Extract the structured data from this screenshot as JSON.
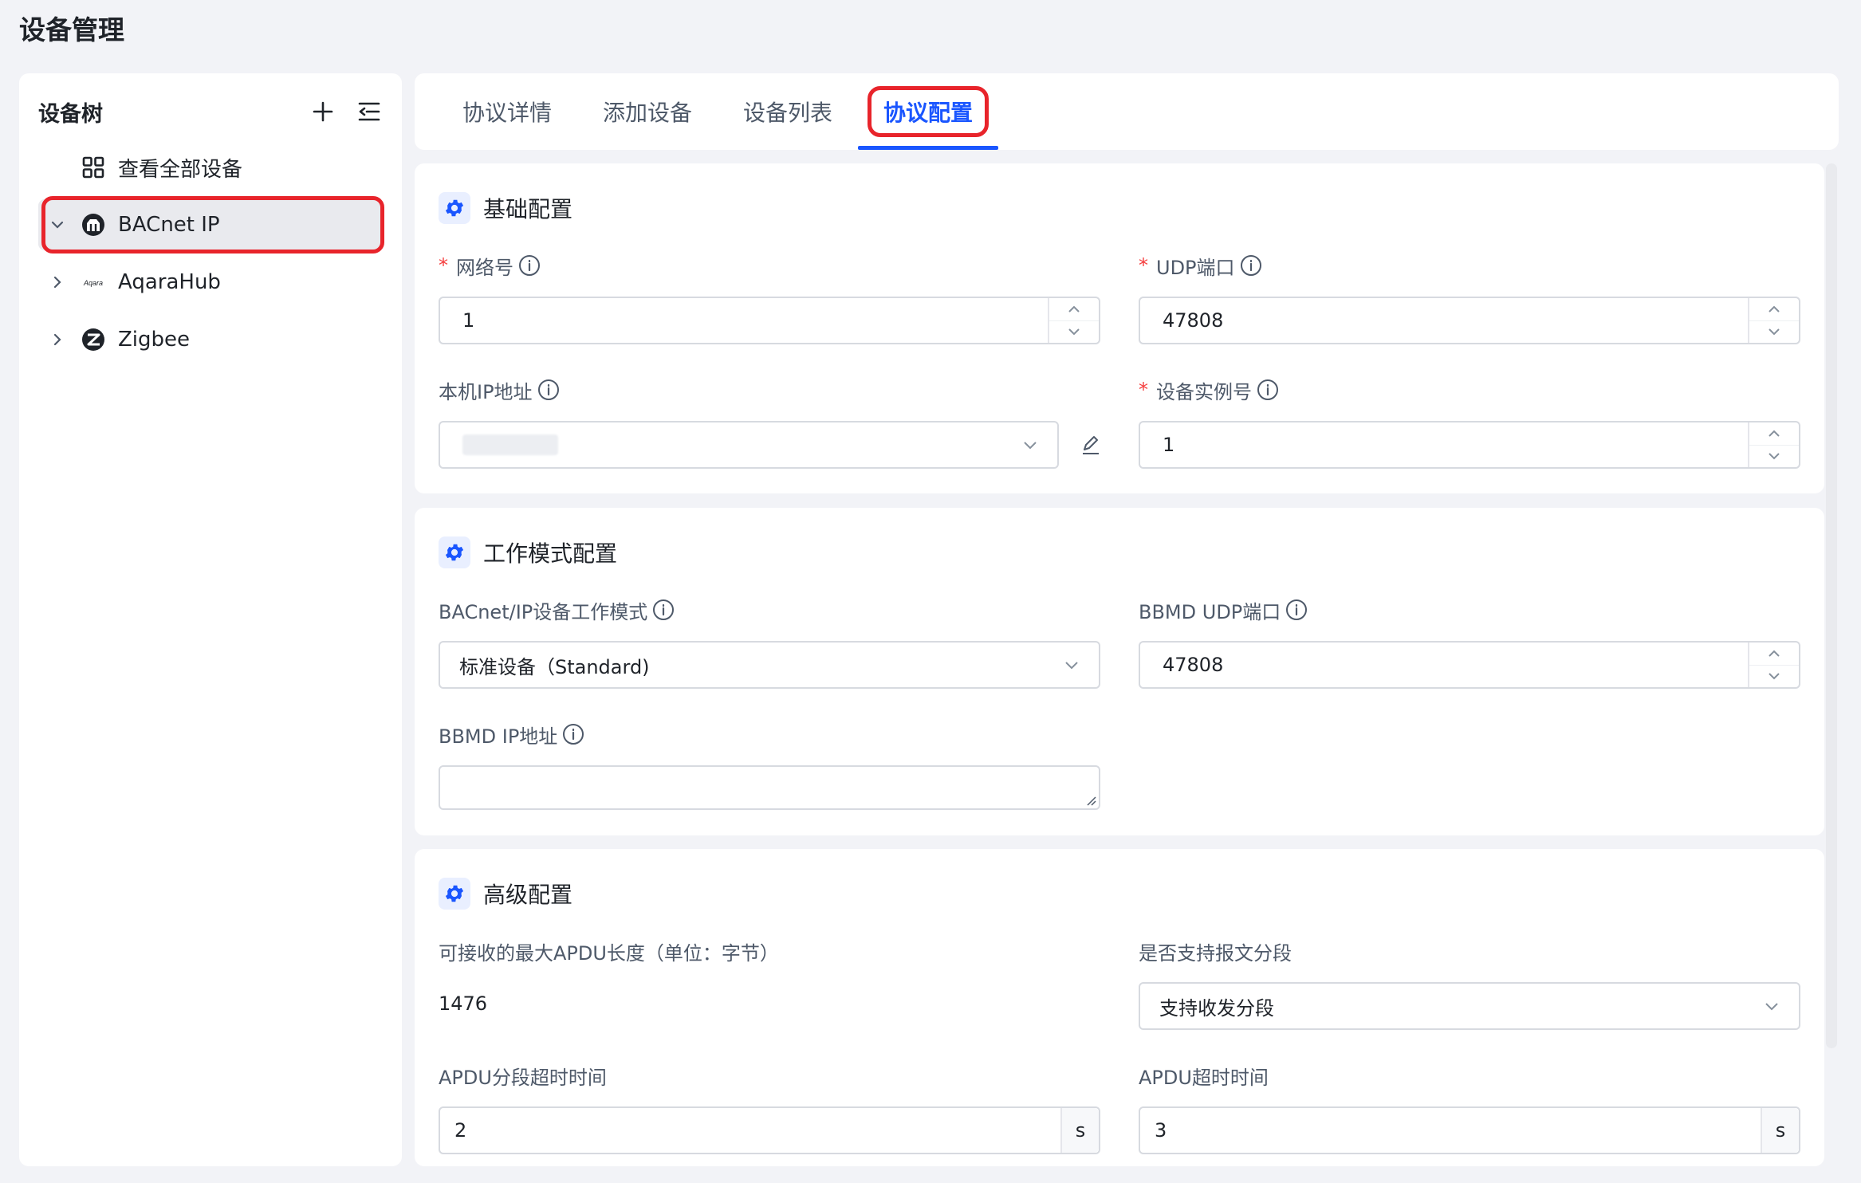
{
  "page": {
    "title": "设备管理"
  },
  "sidebar": {
    "title": "设备树",
    "items": [
      {
        "label": "查看全部设备"
      },
      {
        "label": "BACnet IP"
      },
      {
        "label": "AqaraHub",
        "logo_text": "Aqara"
      },
      {
        "label": "Zigbee"
      }
    ]
  },
  "tabs": [
    {
      "label": "协议详情"
    },
    {
      "label": "添加设备"
    },
    {
      "label": "设备列表"
    },
    {
      "label": "协议配置"
    }
  ],
  "sections": {
    "basic": {
      "title": "基础配置",
      "network_number": {
        "label": "网络号",
        "value": "1"
      },
      "udp_port": {
        "label": "UDP端口",
        "value": "47808"
      },
      "local_ip": {
        "label": "本机IP地址",
        "value": ""
      },
      "device_instance": {
        "label": "设备实例号",
        "value": "1"
      }
    },
    "mode": {
      "title": "工作模式配置",
      "work_mode": {
        "label": "BACnet/IP设备工作模式",
        "value": "标准设备（Standard)"
      },
      "bbmd_udp_port": {
        "label": "BBMD UDP端口",
        "value": "47808"
      },
      "bbmd_ip": {
        "label": "BBMD IP地址",
        "value": ""
      }
    },
    "advanced": {
      "title": "高级配置",
      "max_apdu": {
        "label": "可接收的最大APDU长度（单位：字节）",
        "value": "1476"
      },
      "segmentation": {
        "label": "是否支持报文分段",
        "value": "支持收发分段"
      },
      "apdu_seg_timeout": {
        "label": "APDU分段超时时间",
        "value": "2",
        "unit": "s"
      },
      "apdu_timeout": {
        "label": "APDU超时时间",
        "value": "3",
        "unit": "s"
      }
    }
  },
  "colors": {
    "accent": "#1a56ff",
    "highlight": "#e8242b",
    "required": "#f53f3f"
  }
}
